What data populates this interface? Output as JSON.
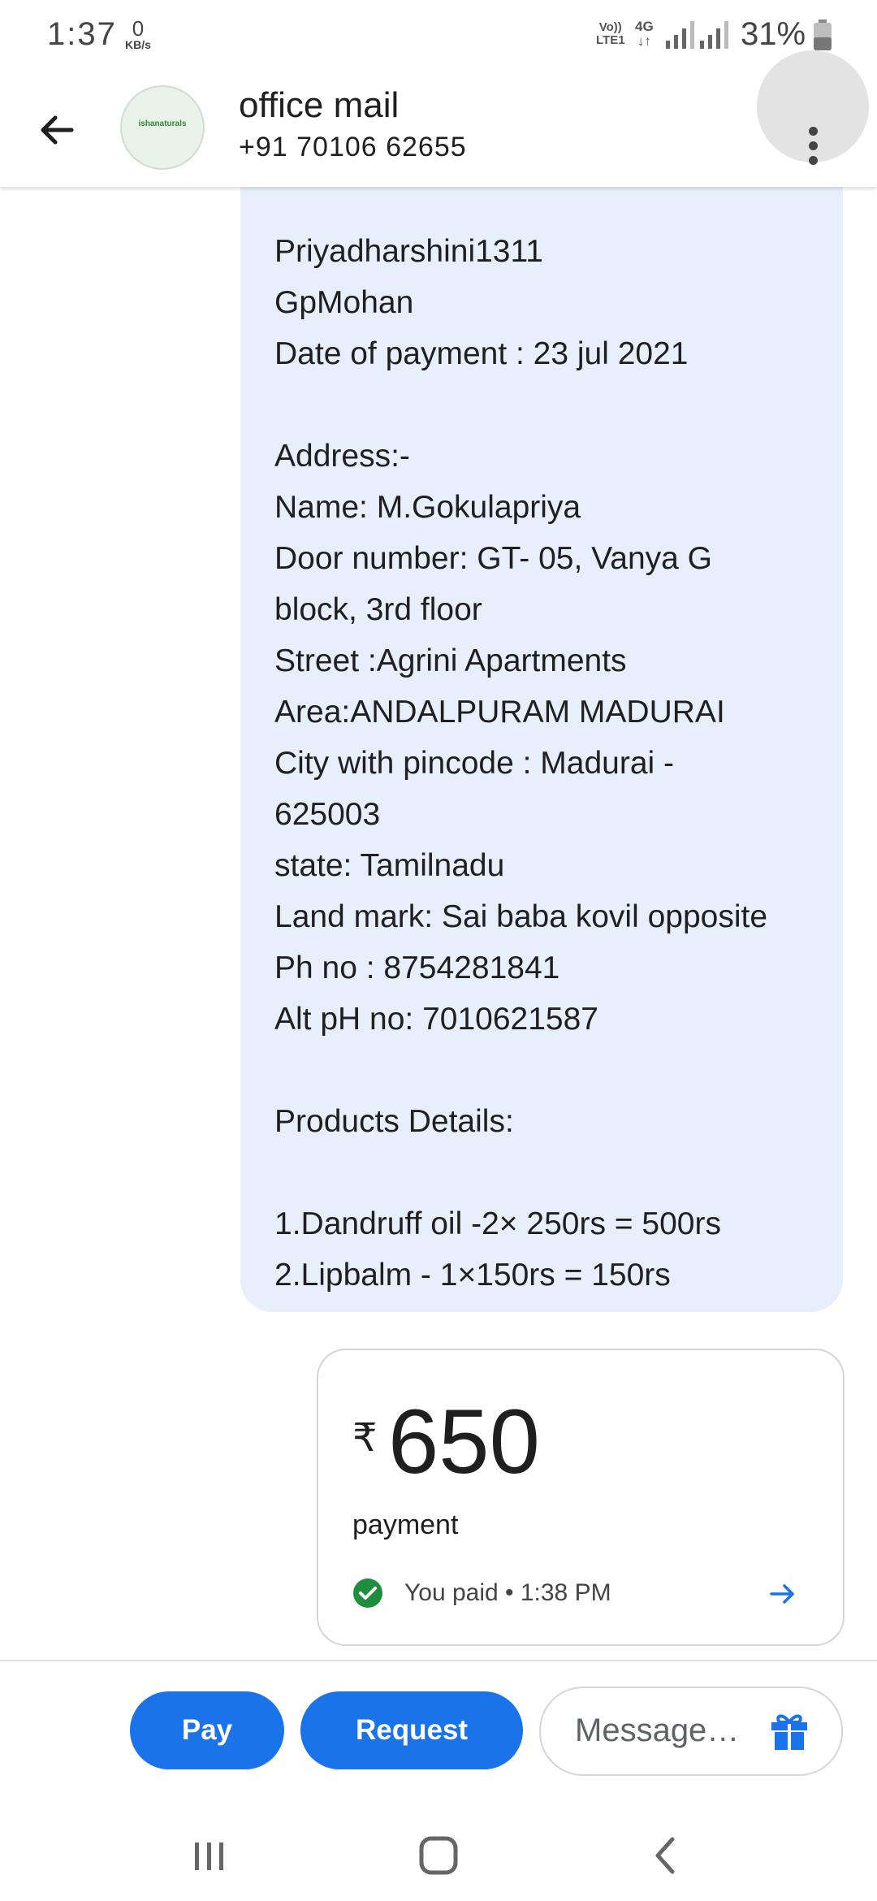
{
  "status_bar": {
    "time": "1:37",
    "net_speed_value": "0",
    "net_speed_unit": "KB/s",
    "volte_line1": "Vo))",
    "volte_line2": "LTE1",
    "network_type": "4G",
    "battery_percent": "31%"
  },
  "header": {
    "back_icon": "arrow-left-icon",
    "avatar_text": "ishanaturals",
    "contact_name": "office mail",
    "contact_phone": "+91 70106 62655",
    "menu_icon": "more-vertical-icon"
  },
  "message": {
    "lines": [
      "Priyadharshini1311",
      "GpMohan",
      "Date of payment : 23 jul 2021",
      "",
      "Address:-",
      "Name: M.Gokulapriya",
      "Door number: GT- 05, Vanya G",
      "block, 3rd floor",
      "Street :Agrini Apartments",
      "Area:ANDALPURAM MADURAI",
      "City  with pincode : Madurai -",
      "625003",
      "state: Tamilnadu",
      "Land mark: Sai baba kovil opposite",
      "Ph no : 8754281841",
      "Alt pH no: 7010621587",
      "",
      "Products Details:",
      "",
      "1.Dandruff oil -2× 250rs = 500rs",
      "2.Lipbalm - 1×150rs = 150rs"
    ]
  },
  "payment": {
    "currency_symbol": "₹",
    "amount": "650",
    "label": "payment",
    "status": "You paid • 1:38 PM",
    "status_color": "#1e8e3e",
    "arrow_color": "#1a73e8"
  },
  "composer": {
    "pay_label": "Pay",
    "request_label": "Request",
    "message_placeholder": "Message…",
    "gift_icon": "gift-icon",
    "accent": "#1a73e8"
  },
  "nav": {
    "recents_icon": "recents-icon",
    "home_icon": "home-icon",
    "back_icon": "back-icon"
  }
}
